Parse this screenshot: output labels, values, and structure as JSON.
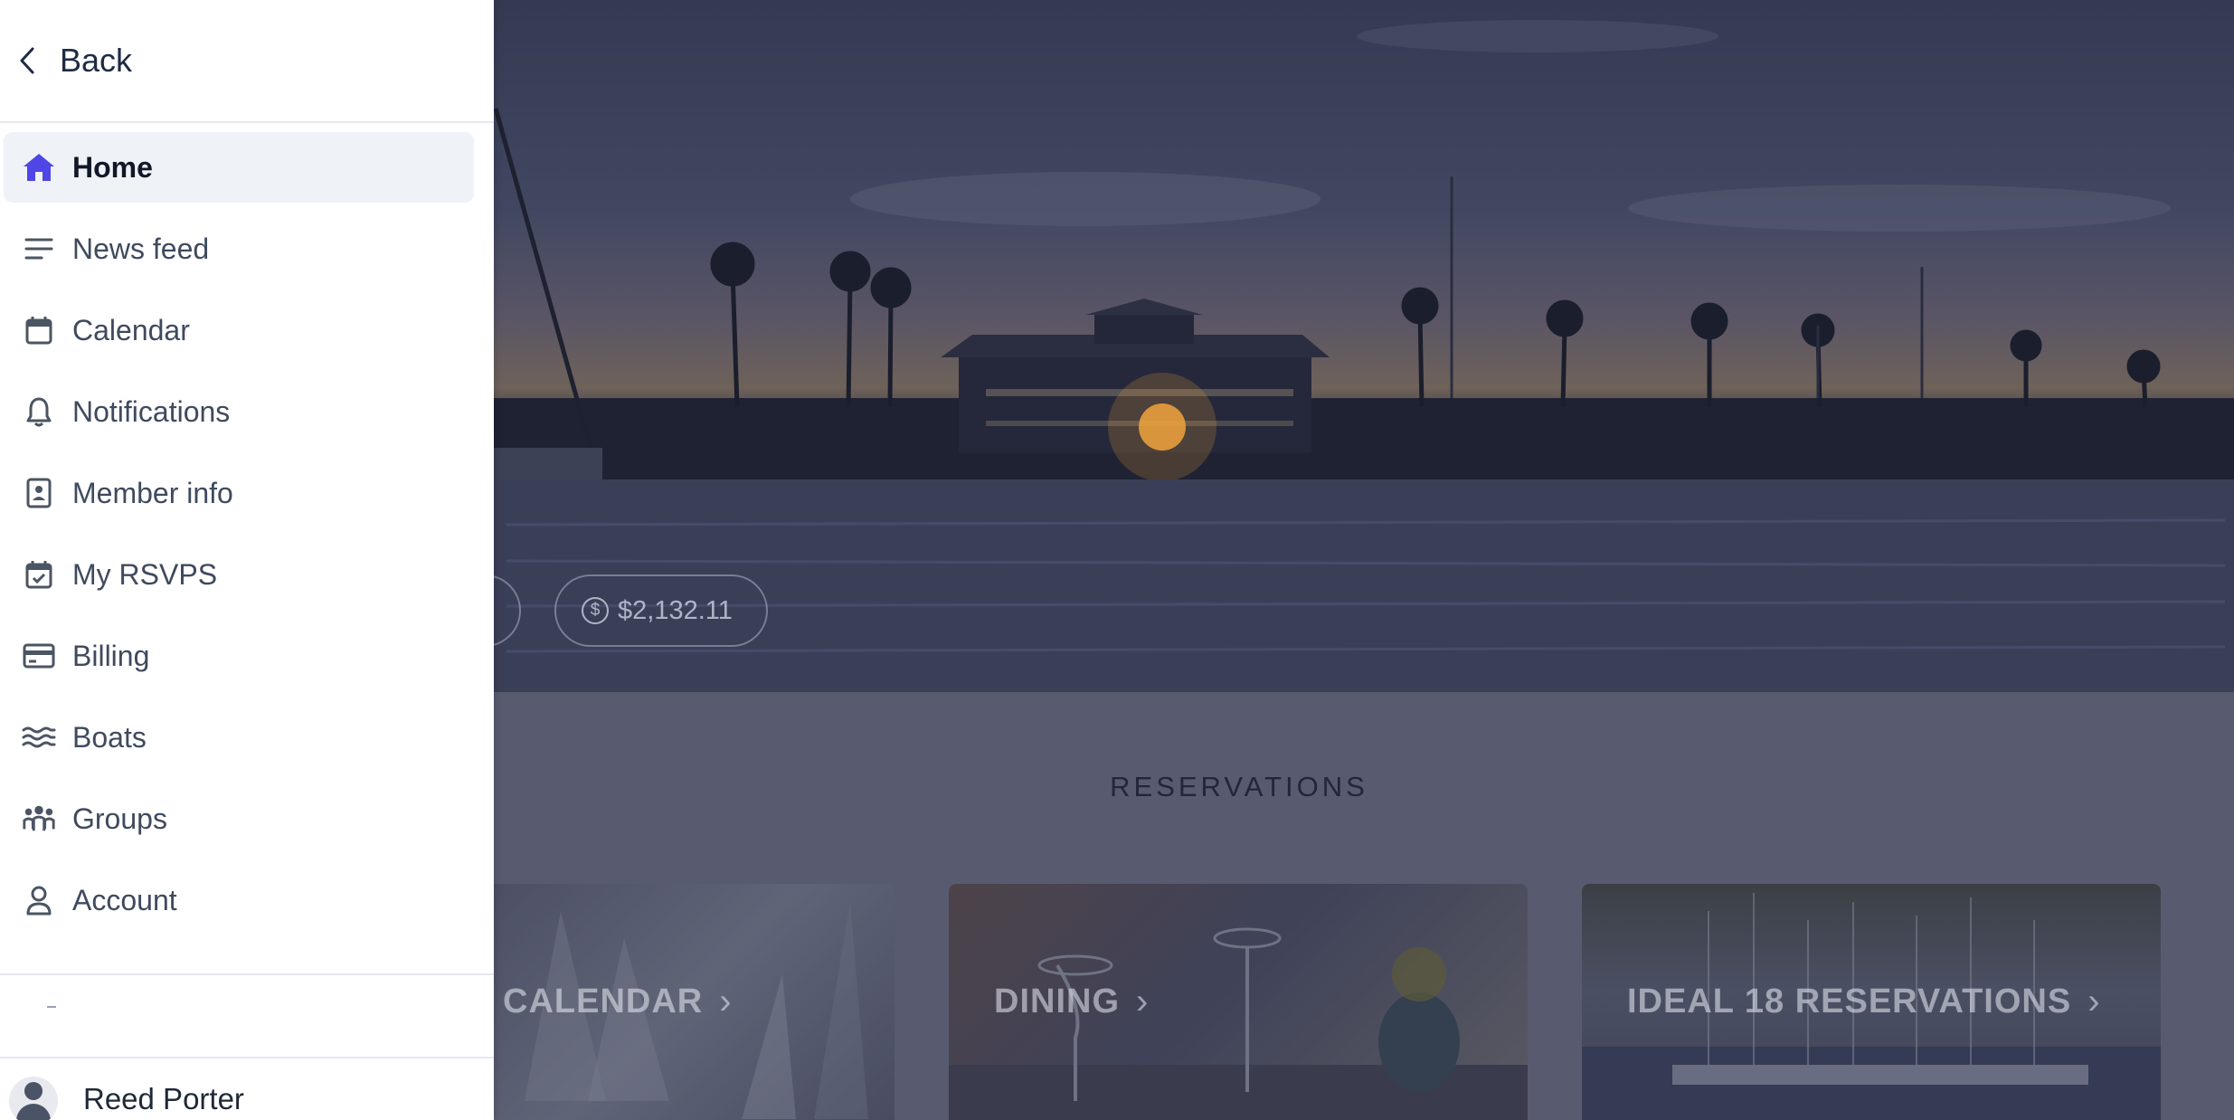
{
  "drawer": {
    "back_label": "Back",
    "items": [
      {
        "label": "Home",
        "icon": "home-icon",
        "active": true
      },
      {
        "label": "News feed",
        "icon": "menu-lines-icon",
        "active": false
      },
      {
        "label": "Calendar",
        "icon": "calendar-icon",
        "active": false
      },
      {
        "label": "Notifications",
        "icon": "bell-icon",
        "active": false
      },
      {
        "label": "Member info",
        "icon": "id-card-icon",
        "active": false
      },
      {
        "label": "My RSVPS",
        "icon": "calendar-check-icon",
        "active": false
      },
      {
        "label": "Billing",
        "icon": "credit-card-icon",
        "active": false
      },
      {
        "label": "Boats",
        "icon": "waves-icon",
        "active": false
      },
      {
        "label": "Groups",
        "icon": "group-icon",
        "active": false
      },
      {
        "label": "Account",
        "icon": "user-icon",
        "active": false
      }
    ],
    "user_name": "Reed Porter"
  },
  "main": {
    "balance": "$2,132.11",
    "section_title": "RESERVATIONS",
    "cards": [
      {
        "label": "CALENDAR"
      },
      {
        "label": "DINING"
      },
      {
        "label": "IDEAL 18 RESERVATIONS"
      }
    ]
  },
  "colors": {
    "accent": "#4f46e5",
    "drawer_bg": "#ffffff",
    "active_item_bg": "#eff2f6",
    "overlay": "#585b6f"
  }
}
